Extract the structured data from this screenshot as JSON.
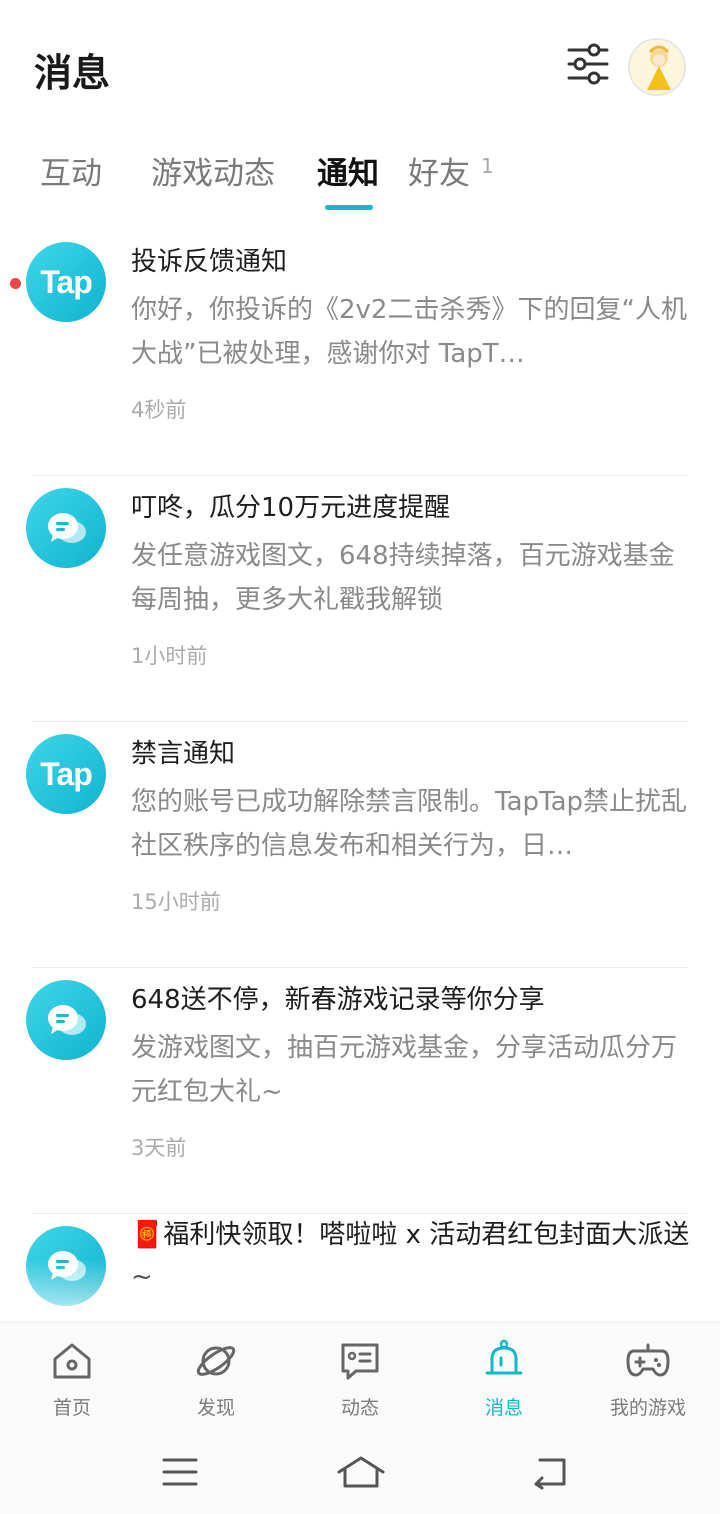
{
  "header": {
    "title": "消息",
    "filter_icon": "sliders-icon",
    "avatar": "user-avatar"
  },
  "tabs": [
    {
      "label": "互动",
      "active": false
    },
    {
      "label": "游戏动态",
      "active": false
    },
    {
      "label": "通知",
      "active": true
    },
    {
      "label": "好友",
      "active": false,
      "badge": "1"
    }
  ],
  "notifications": [
    {
      "icon": "tap-logo",
      "icon_text": "Tap",
      "unread": true,
      "title": "投诉反馈通知",
      "body": "你好，你投诉的《2v2二击杀秀》下的回复“人机大战”已被处理，感谢你对 TapT…",
      "time": "4秒前"
    },
    {
      "icon": "chat-bubble-icon",
      "unread": false,
      "title": "叮咚，瓜分10万元进度提醒",
      "body": "发任意游戏图文，648持续掉落，百元游戏基金每周抽，更多大礼戳我解锁",
      "time": "1小时前"
    },
    {
      "icon": "tap-logo",
      "icon_text": "Tap",
      "unread": false,
      "title": "禁言通知",
      "body": "您的账号已成功解除禁言限制。TapTap禁止扰乱社区秩序的信息发布和相关行为，日…",
      "time": "15小时前"
    },
    {
      "icon": "chat-bubble-icon",
      "unread": false,
      "title": "648送不停，新春游戏记录等你分享",
      "body": "发游戏图文，抽百元游戏基金，分享活动瓜分万元红包大礼~",
      "time": "3天前"
    },
    {
      "icon": "chat-bubble-icon",
      "unread": false,
      "title": "🧧福利快领取！嗒啦啦 x 活动君红包封面大派送~",
      "body": "",
      "time": ""
    }
  ],
  "bottom_nav": [
    {
      "label": "首页",
      "icon": "home-icon",
      "active": false
    },
    {
      "label": "发现",
      "icon": "planet-icon",
      "active": false
    },
    {
      "label": "动态",
      "icon": "feed-icon",
      "active": false
    },
    {
      "label": "消息",
      "icon": "bell-icon",
      "active": true
    },
    {
      "label": "我的游戏",
      "icon": "gamepad-icon",
      "active": false
    }
  ],
  "colors": {
    "accent": "#14b9c8",
    "unread_dot": "#f0454b",
    "title_text": "#1e1e1e",
    "body_text": "#8a8a8a",
    "time_text": "#ababab"
  }
}
